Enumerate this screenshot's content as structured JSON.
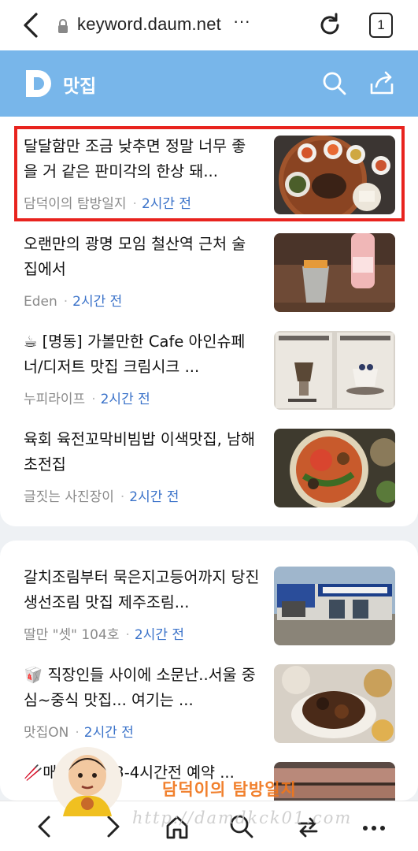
{
  "browser": {
    "url": "keyword.daum.net",
    "url_more": "···",
    "tab_count": "1"
  },
  "header": {
    "title": "맛집",
    "brand_color": "#78b6ea"
  },
  "articles": [
    {
      "headline": "달달함만 조금 낮추면 정말 너무 좋을 거 같은 판미각의 한상 돼...",
      "source": "담덕이의 탐방일지",
      "time": "2시간 전",
      "thumbnail": "korean-table-setting"
    },
    {
      "headline": "오랜만의 광명 모임 철산역 근처 술집에서",
      "source": "Eden",
      "time": "2시간 전",
      "thumbnail": "drinks-on-table"
    },
    {
      "headline": "☕ [명동] 가볼만한 Cafe 아인슈페너/디저트 맛집 크림시크 ...",
      "source": "누피라이프",
      "time": "2시간 전",
      "thumbnail": "cafe-menu-photos"
    },
    {
      "headline": "육회 육전꼬막비빔밥 이색맛집, 남해 초전집",
      "source": "글짓는 사진장이",
      "time": "2시간 전",
      "thumbnail": "bibimbap-dish"
    },
    {
      "headline": "갈치조림부터 묵은지고등어까지 당진 생선조림 맛집 제주조림...",
      "source": "딸만 \"셋\" 104호",
      "time": "2시간 전",
      "thumbnail": "restaurant-storefront"
    },
    {
      "headline": "🥡 직장인들 사이에 소문난..서울 중심~중식 맛집... 여기는 ...",
      "source": "맛집ON",
      "time": "2시간 전",
      "thumbnail": "chinese-food-plates"
    },
    {
      "headline": "🥢매운 ... 은 3-4시간전 예약 ...",
      "source": "",
      "time": "",
      "thumbnail": "grilled-meat"
    }
  ],
  "overlay": {
    "blog_name": "담덕이의 탐방일지",
    "blog_url": "http://damdkck01.com",
    "highlight_color": "#e8231e"
  },
  "icons": [
    "back-icon",
    "lock-icon",
    "reload-icon",
    "tabs-icon",
    "daum-logo-icon",
    "search-icon",
    "share-icon",
    "nav-back-icon",
    "nav-forward-icon",
    "home-icon",
    "nav-search-icon",
    "tabs-switch-icon",
    "more-icon"
  ]
}
